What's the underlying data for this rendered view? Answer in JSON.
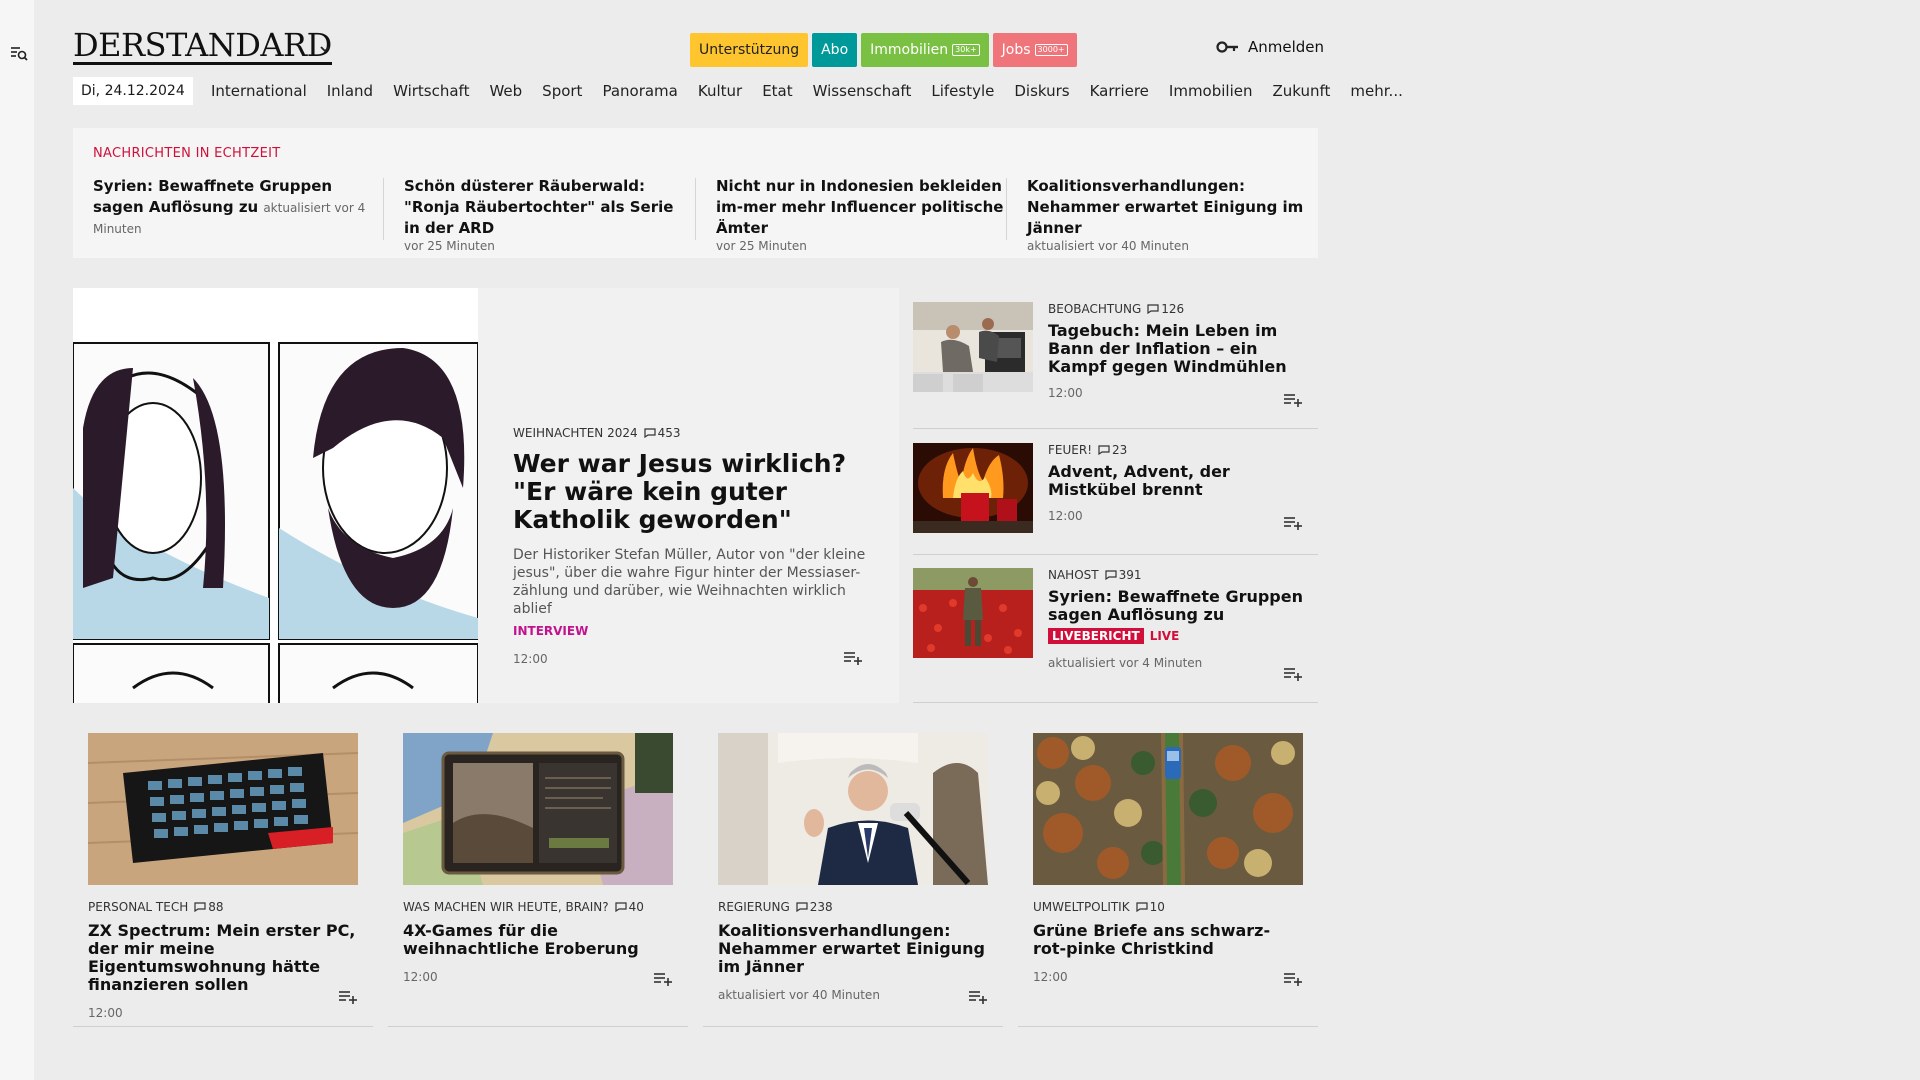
{
  "header": {
    "logo": "DERSTANDARD",
    "buttons": {
      "support": "Unterstützung",
      "abo": "Abo",
      "immo": "Immobilien",
      "immo_badge": "30k+",
      "jobs": "Jobs",
      "jobs_badge": "3000+"
    },
    "login": "Anmelden",
    "date": "Di, 24.12.2024",
    "nav": [
      "International",
      "Inland",
      "Wirtschaft",
      "Web",
      "Sport",
      "Panorama",
      "Kultur",
      "Etat",
      "Wissenschaft",
      "Lifestyle",
      "Diskurs",
      "Karriere",
      "Immobilien",
      "Zukunft",
      "mehr..."
    ]
  },
  "ticker": {
    "title": "NACHRICHTEN IN ECHTZEIT",
    "items": [
      {
        "headline": "Syrien: Bewaffnete Gruppen sagen Auflösung zu",
        "meta": "aktualisiert vor 4 Minuten"
      },
      {
        "headline": "Schön düsterer Räuberwald: \"Ronja Räubertochter\" als Serie in der ARD",
        "meta": "vor 25 Minuten"
      },
      {
        "headline": "Nicht nur in Indonesien bekleiden im-mer mehr Influencer politische Ämter",
        "meta": "vor 25 Minuten"
      },
      {
        "headline": "Koalitionsverhandlungen: Nehammer erwartet Einigung im Jänner",
        "meta": "aktualisiert vor 40 Minuten"
      }
    ]
  },
  "hero": {
    "kicker": "WEIHNACHTEN 2024",
    "comments": "453",
    "title": "Wer war Jesus wirklich? \"Er wäre kein guter Katholik geworden\"",
    "teaser": "Der Historiker Stefan Müller, Autor von \"der kleine jesus\", über die wahre Figur hinter der Messiaser-zählung und darüber, wie Weihnachten wirklich ablief",
    "tag": "INTERVIEW",
    "time": "12:00"
  },
  "side": [
    {
      "kicker": "BEOBACHTUNG",
      "comments": "126",
      "title": "Tagebuch: Mein Leben im Bann der Inflation – ein Kampf gegen Windmühlen",
      "time": "12:00"
    },
    {
      "kicker": "FEUER!",
      "comments": "23",
      "title": "Advent, Advent, der Mistkübel brennt",
      "time": "12:00"
    },
    {
      "kicker": "NAHOST",
      "comments": "391",
      "title": "Syrien: Bewaffnete Gruppen sagen Auflösung zu",
      "live_badge": "LIVEBERICHT",
      "live": "LIVE",
      "time": "aktualisiert vor 4 Minuten"
    }
  ],
  "cards": [
    {
      "kicker": "PERSONAL TECH",
      "comments": "88",
      "title": "ZX Spectrum: Mein erster PC, der mir meine Eigentumswohnung hätte finanzieren sollen",
      "time": "12:00"
    },
    {
      "kicker": "WAS MACHEN WIR HEUTE, BRAIN?",
      "comments": "40",
      "title": "4X-Games für die weihnachtliche Eroberung",
      "time": "12:00"
    },
    {
      "kicker": "REGIERUNG",
      "comments": "238",
      "title": "Koalitionsverhandlungen: Nehammer erwartet Einigung im Jänner",
      "time": "aktualisiert vor 40 Minuten"
    },
    {
      "kicker": "UMWELTPOLITIK",
      "comments": "10",
      "title": "Grüne Briefe ans schwarz-rot-pinke Christkind",
      "time": "12:00"
    }
  ],
  "colors": {
    "accent_red": "#d0103a",
    "support": "#ffc52e",
    "abo": "#009999",
    "immo": "#7ac143",
    "jobs": "#f0757a",
    "interview": "#c0138d"
  }
}
